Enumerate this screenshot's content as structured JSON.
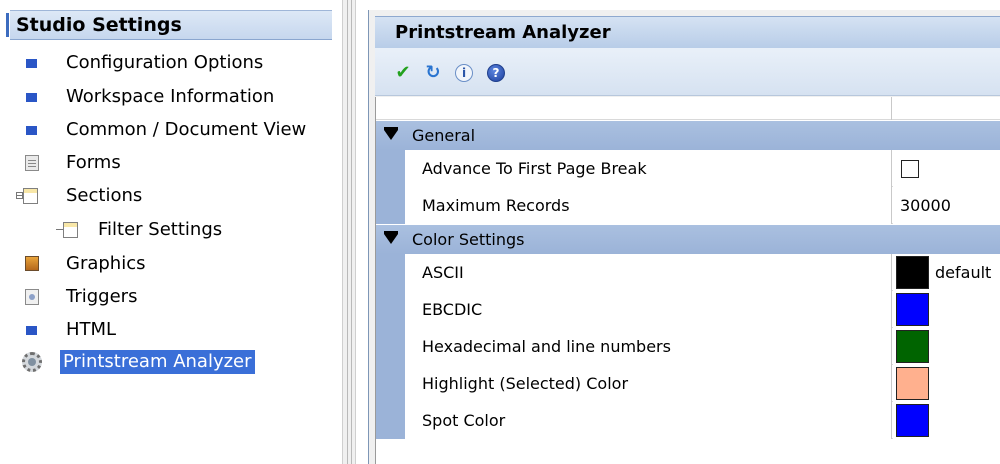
{
  "sidebar": {
    "header": "Studio Settings",
    "items": [
      {
        "label": "Configuration Options",
        "icon": "blue-square-icon"
      },
      {
        "label": "Workspace Information",
        "icon": "blue-square-icon"
      },
      {
        "label": "Common / Document View",
        "icon": "blue-square-icon"
      },
      {
        "label": "Forms",
        "icon": "document-icon"
      },
      {
        "label": "Sections",
        "icon": "sections-icon"
      },
      {
        "label": "Filter Settings",
        "icon": "section-page-icon"
      },
      {
        "label": "Graphics",
        "icon": "picture-icon"
      },
      {
        "label": "Triggers",
        "icon": "trigger-icon"
      },
      {
        "label": "HTML",
        "icon": "blue-square-icon"
      },
      {
        "label": "Printstream Analyzer",
        "icon": "gear-icon",
        "selected": true
      }
    ]
  },
  "panel": {
    "title": "Printstream Analyzer",
    "toolbar": [
      "check-icon",
      "refresh-icon",
      "info-icon",
      "help-icon"
    ],
    "categories": [
      {
        "label": "General",
        "properties": [
          {
            "name": "Advance To First Page Break",
            "value": "",
            "type": "checkbox",
            "checked": false
          },
          {
            "name": "Maximum Records",
            "value": "30000"
          }
        ]
      },
      {
        "label": "Color Settings",
        "properties": [
          {
            "name": "ASCII",
            "color": "#000000",
            "value": "default"
          },
          {
            "name": "EBCDIC",
            "color": "#0000ff"
          },
          {
            "name": "Hexadecimal and line numbers",
            "color": "#006400"
          },
          {
            "name": "Highlight (Selected) Color",
            "color": "#ffb08e"
          },
          {
            "name": "Spot Color",
            "color": "#0000ff"
          }
        ]
      }
    ]
  }
}
